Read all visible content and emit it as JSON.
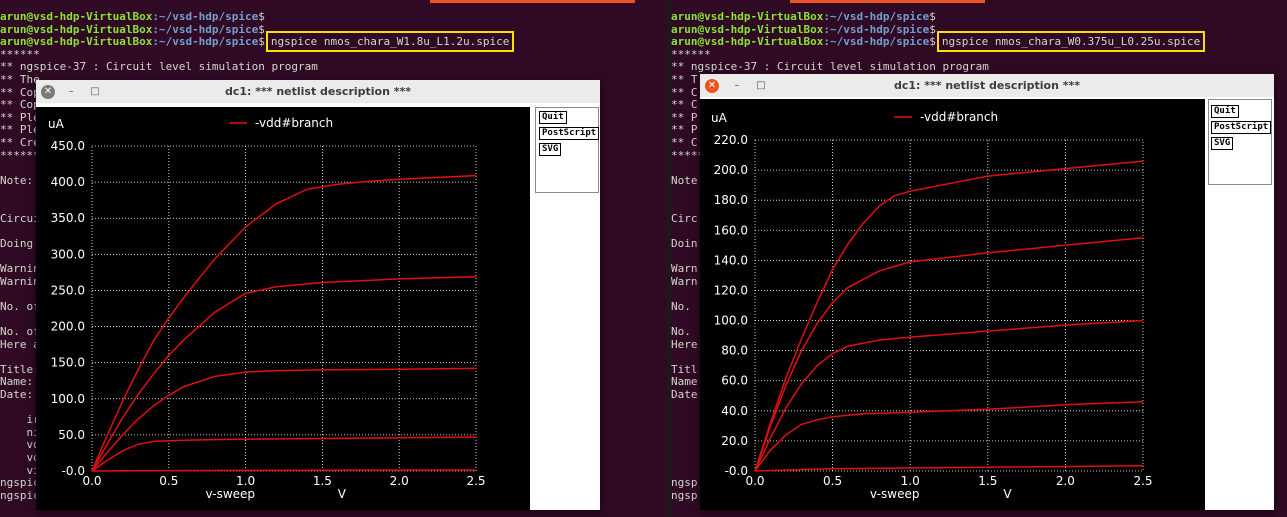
{
  "left_terminal": {
    "lines": [
      {
        "type": "prompt",
        "user": "arun@vsd-hdp-VirtualBox",
        "path": ":~/vsd-hdp/spice",
        "suffix": "$",
        "cmd": ""
      },
      {
        "type": "prompt",
        "user": "arun@vsd-hdp-VirtualBox",
        "path": ":~/vsd-hdp/spice",
        "suffix": "$",
        "cmd": ""
      },
      {
        "type": "prompt",
        "user": "arun@vsd-hdp-VirtualBox",
        "path": ":~/vsd-hdp/spice",
        "suffix": "$",
        "cmd": "ngspice nmos_chara_W1.8u_L1.2u.spice",
        "highlight": true
      },
      {
        "type": "text",
        "text": "******"
      },
      {
        "type": "text",
        "text": "** ngspice-37 : Circuit level simulation program"
      },
      {
        "type": "text",
        "text": "** The"
      },
      {
        "type": "text",
        "text": "** Cop"
      },
      {
        "type": "text",
        "text": "** Cop"
      },
      {
        "type": "text",
        "text": "** Ple"
      },
      {
        "type": "text",
        "text": "** Ple"
      },
      {
        "type": "text",
        "text": "** Cre"
      },
      {
        "type": "text",
        "text": "******"
      },
      {
        "type": "text",
        "text": ""
      },
      {
        "type": "text",
        "text": "Note:"
      },
      {
        "type": "text",
        "text": ""
      },
      {
        "type": "text",
        "text": ""
      },
      {
        "type": "text",
        "text": "Circui"
      },
      {
        "type": "text",
        "text": ""
      },
      {
        "type": "text",
        "text": "Doing"
      },
      {
        "type": "text",
        "text": ""
      },
      {
        "type": "text",
        "text": "Warnin"
      },
      {
        "type": "text",
        "text": "Warnin"
      },
      {
        "type": "text",
        "text": ""
      },
      {
        "type": "text",
        "text": "No. of"
      },
      {
        "type": "text",
        "text": ""
      },
      {
        "type": "text",
        "text": "No. of"
      },
      {
        "type": "text",
        "text": "Here a"
      },
      {
        "type": "text",
        "text": ""
      },
      {
        "type": "text",
        "text": "Title:"
      },
      {
        "type": "text",
        "text": "Name:"
      },
      {
        "type": "text",
        "text": "Date:"
      },
      {
        "type": "text",
        "text": ""
      },
      {
        "type": "text",
        "text": "    ir"
      },
      {
        "type": "text",
        "text": "    ni"
      },
      {
        "type": "text",
        "text": "    vo"
      },
      {
        "type": "text",
        "text": "    vo"
      },
      {
        "type": "text",
        "text": "    vi"
      },
      {
        "type": "text",
        "text": "ngspic"
      },
      {
        "type": "text",
        "text": "ngspic"
      }
    ]
  },
  "right_terminal": {
    "lines": [
      {
        "type": "prompt",
        "user": "arun@vsd-hdp-VirtualBox",
        "path": ":~/vsd-hdp/spice",
        "suffix": "$",
        "cmd": ""
      },
      {
        "type": "prompt",
        "user": "arun@vsd-hdp-VirtualBox",
        "path": ":~/vsd-hdp/spice",
        "suffix": "$",
        "cmd": ""
      },
      {
        "type": "prompt",
        "user": "arun@vsd-hdp-VirtualBox",
        "path": ":~/vsd-hdp/spice",
        "suffix": "$",
        "cmd": "ngspice nmos_chara_W0.375u_L0.25u.spice",
        "highlight": true
      },
      {
        "type": "text",
        "text": "******"
      },
      {
        "type": "text",
        "text": "** ngspice-37 : Circuit level simulation program"
      },
      {
        "type": "text",
        "text": "** T"
      },
      {
        "type": "text",
        "text": "** C"
      },
      {
        "type": "text",
        "text": "** C"
      },
      {
        "type": "text",
        "text": "** P"
      },
      {
        "type": "text",
        "text": "** P"
      },
      {
        "type": "text",
        "text": "** C"
      },
      {
        "type": "text",
        "text": "*****"
      },
      {
        "type": "text",
        "text": ""
      },
      {
        "type": "text",
        "text": "Note"
      },
      {
        "type": "text",
        "text": ""
      },
      {
        "type": "text",
        "text": ""
      },
      {
        "type": "text",
        "text": "Circ"
      },
      {
        "type": "text",
        "text": ""
      },
      {
        "type": "text",
        "text": "Doin"
      },
      {
        "type": "text",
        "text": ""
      },
      {
        "type": "text",
        "text": "Warn"
      },
      {
        "type": "text",
        "text": "Warn"
      },
      {
        "type": "text",
        "text": ""
      },
      {
        "type": "text",
        "text": "No."
      },
      {
        "type": "text",
        "text": ""
      },
      {
        "type": "text",
        "text": "No."
      },
      {
        "type": "text",
        "text": "Here"
      },
      {
        "type": "text",
        "text": ""
      },
      {
        "type": "text",
        "text": "Titl"
      },
      {
        "type": "text",
        "text": "Name"
      },
      {
        "type": "text",
        "text": "Date"
      },
      {
        "type": "text",
        "text": ""
      },
      {
        "type": "text",
        "text": ""
      },
      {
        "type": "text",
        "text": ""
      },
      {
        "type": "text",
        "text": ""
      },
      {
        "type": "text",
        "text": ""
      },
      {
        "type": "text",
        "text": ""
      },
      {
        "type": "text",
        "text": "ngsp"
      },
      {
        "type": "text",
        "text": "ngsp"
      }
    ]
  },
  "left_window": {
    "title": "dc1: *** netlist description ***",
    "buttons": {
      "quit": "Quit",
      "postscript": "PostScript",
      "svg": "SVG"
    }
  },
  "right_window": {
    "title": "dc1: *** netlist description ***",
    "buttons": {
      "quit": "Quit",
      "postscript": "PostScript",
      "svg": "SVG"
    }
  },
  "chart_data": [
    {
      "type": "line",
      "ylabel": "uA",
      "xlabel": "v-sweep",
      "xunit": "V",
      "legend": "-vdd#branch",
      "legend_position": "top-center",
      "grid": true,
      "xlim": [
        0,
        2.5
      ],
      "ylim": [
        0,
        450
      ],
      "xticks": [
        "0.0",
        "0.5",
        "1.0",
        "1.5",
        "2.0",
        "2.5"
      ],
      "yticks": [
        "-0.0",
        "50.0",
        "100.0",
        "150.0",
        "200.0",
        "250.0",
        "300.0",
        "350.0",
        "400.0",
        "450.0"
      ],
      "colors": {
        "background": "#000000",
        "grid": "#ffffff",
        "line": "#e01010",
        "text": "#ffffff"
      },
      "series": [
        {
          "x": [
            0,
            0.5,
            1.0,
            1.5,
            2.0,
            2.5
          ],
          "values": [
            0,
            0.5,
            0.8,
            1.0,
            1.2,
            1.4
          ]
        },
        {
          "x": [
            0,
            0.1,
            0.2,
            0.3,
            0.4,
            0.5,
            0.7,
            1.0,
            1.5,
            2.0,
            2.5
          ],
          "values": [
            0,
            15,
            28,
            37,
            41,
            42,
            43,
            44,
            45,
            46,
            47
          ]
        },
        {
          "x": [
            0,
            0.1,
            0.2,
            0.3,
            0.4,
            0.5,
            0.6,
            0.8,
            1.0,
            1.2,
            1.5,
            2.0,
            2.5
          ],
          "values": [
            0,
            26,
            50,
            72,
            90,
            105,
            117,
            131,
            137,
            139,
            140,
            141,
            142
          ]
        },
        {
          "x": [
            0,
            0.1,
            0.2,
            0.3,
            0.4,
            0.5,
            0.6,
            0.8,
            1.0,
            1.2,
            1.5,
            2.0,
            2.5
          ],
          "values": [
            0,
            38,
            74,
            106,
            134,
            160,
            182,
            220,
            246,
            255,
            261,
            266,
            269
          ]
        },
        {
          "x": [
            0,
            0.1,
            0.2,
            0.3,
            0.4,
            0.5,
            0.6,
            0.8,
            1.0,
            1.2,
            1.4,
            1.6,
            1.8,
            2.0,
            2.5
          ],
          "values": [
            0,
            50,
            97,
            140,
            180,
            212,
            241,
            294,
            338,
            370,
            390,
            397,
            401,
            404,
            409
          ]
        }
      ]
    },
    {
      "type": "line",
      "ylabel": "uA",
      "xlabel": "v-sweep",
      "xunit": "V",
      "legend": "-vdd#branch",
      "legend_position": "top-center",
      "grid": true,
      "xlim": [
        0,
        2.5
      ],
      "ylim": [
        0,
        220
      ],
      "xticks": [
        "0.0",
        "0.5",
        "1.0",
        "1.5",
        "2.0",
        "2.5"
      ],
      "yticks": [
        "-0.0",
        "20.0",
        "40.0",
        "60.0",
        "80.0",
        "100.0",
        "120.0",
        "140.0",
        "160.0",
        "180.0",
        "200.0",
        "220.0"
      ],
      "colors": {
        "background": "#000000",
        "grid": "#ffffff",
        "line": "#e01010",
        "text": "#ffffff"
      },
      "series": [
        {
          "x": [
            0,
            0.5,
            1.0,
            1.5,
            2.0,
            2.5
          ],
          "values": [
            0,
            1.5,
            2.0,
            2.5,
            3.0,
            3.5
          ]
        },
        {
          "x": [
            0,
            0.1,
            0.2,
            0.3,
            0.4,
            0.5,
            0.7,
            1.0,
            1.5,
            2.0,
            2.5
          ],
          "values": [
            0,
            14,
            24,
            31,
            34,
            36,
            38,
            39,
            41,
            44,
            46
          ]
        },
        {
          "x": [
            0,
            0.1,
            0.2,
            0.3,
            0.4,
            0.5,
            0.6,
            0.8,
            1.0,
            1.5,
            2.0,
            2.5
          ],
          "values": [
            0,
            22,
            42,
            58,
            70,
            78,
            83,
            87,
            89,
            93,
            97,
            100
          ]
        },
        {
          "x": [
            0,
            0.1,
            0.2,
            0.3,
            0.4,
            0.5,
            0.6,
            0.8,
            1.0,
            1.5,
            2.0,
            2.5
          ],
          "values": [
            0,
            30,
            57,
            80,
            98,
            112,
            122,
            133,
            139,
            145,
            150,
            155
          ]
        },
        {
          "x": [
            0,
            0.1,
            0.2,
            0.3,
            0.4,
            0.5,
            0.6,
            0.7,
            0.8,
            0.9,
            1.0,
            1.5,
            2.0,
            2.5
          ],
          "values": [
            0,
            32,
            62,
            88,
            112,
            134,
            151,
            165,
            176,
            183,
            186,
            196,
            201,
            206
          ]
        }
      ]
    }
  ]
}
